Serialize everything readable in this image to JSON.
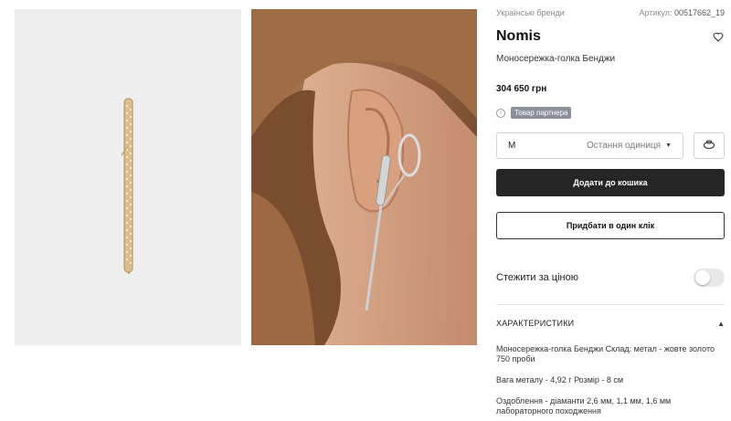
{
  "product": {
    "category": "Українські бренди",
    "article_label": "Артикул:",
    "article_value": "00517662_19",
    "brand": "Nomis",
    "name": "Моносережка-голка Бенджи",
    "price": "304 650 грн",
    "partner_badge": "Товар партнера",
    "size_value": "M",
    "size_status": "Остання одиниця",
    "add_to_cart": "Додати до кошика",
    "buy_one_click": "Придбати в один клік",
    "price_watch_label": "Стежити за ціною",
    "price_watch_enabled": false
  },
  "specs": {
    "title": "ХАРАКТЕРИСТИКИ",
    "lines": [
      "Моносережка-голка Бенджи Склад: метал - жовте золото 750 проби",
      "Вага металу - 4,92 г Розмір - 8 см",
      "Оздоблення - діаманти 2,6 мм, 1,1 мм, 1,6 мм лабораторного походження"
    ]
  },
  "colors": {
    "primary_button": "#262626",
    "badge": "#8a8f99",
    "image_bg": "#eeeeee"
  },
  "icons": [
    "heart-icon",
    "info-icon",
    "chevron-down-icon",
    "ring-size-icon",
    "chevron-up-icon"
  ]
}
